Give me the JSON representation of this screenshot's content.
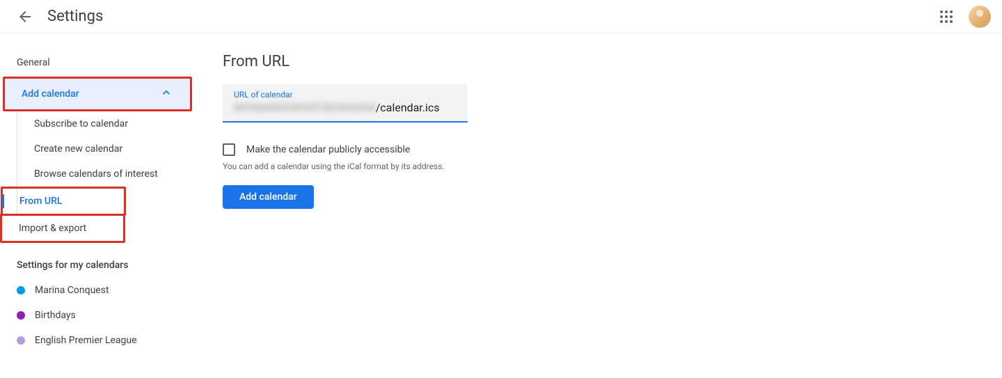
{
  "header": {
    "title": "Settings"
  },
  "sidebar": {
    "general": "General",
    "add_calendar": "Add calendar",
    "sub_items": {
      "subscribe": "Subscribe to calendar",
      "create_new": "Create new calendar",
      "browse": "Browse calendars of interest",
      "from_url": "From URL"
    },
    "import_export": "Import & export",
    "settings_for_calendars": "Settings for my calendars",
    "calendars": [
      {
        "name": "Marina Conquest",
        "color": "#039be5"
      },
      {
        "name": "Birthdays",
        "color": "#8e24aa"
      },
      {
        "name": "English Premier League",
        "color": "#b39ddb"
      }
    ]
  },
  "main": {
    "title": "From URL",
    "url_field": {
      "label": "URL of calendar",
      "blurred": "869584969285357503694303",
      "suffix": "/calendar.ics"
    },
    "checkbox_label": "Make the calendar publicly accessible",
    "help_text": "You can add a calendar using the iCal format by its address.",
    "add_button": "Add calendar"
  }
}
